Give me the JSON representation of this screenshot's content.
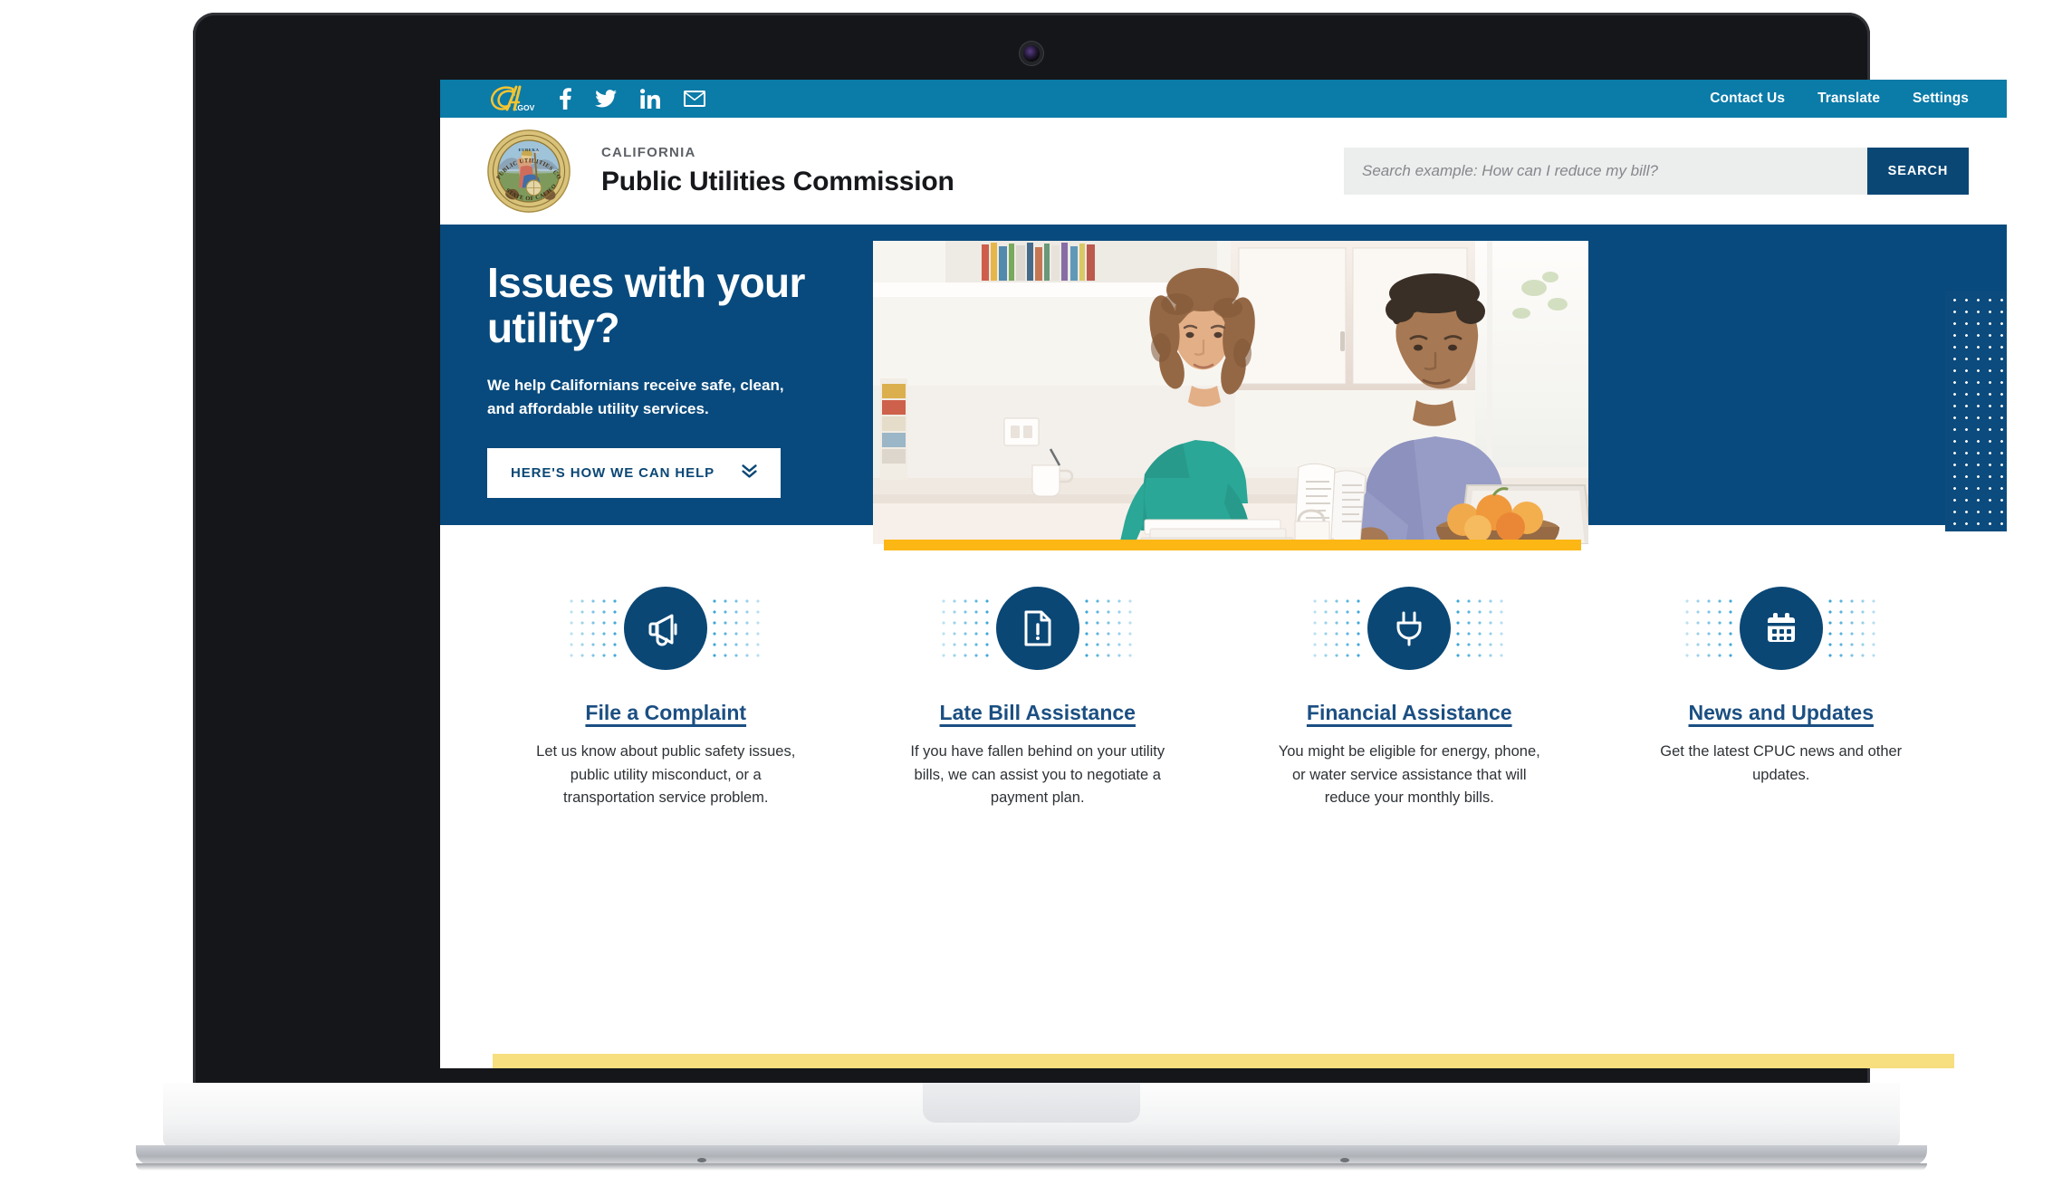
{
  "topbar": {
    "logo_alt": "CA.gov",
    "social": [
      {
        "name": "facebook-icon",
        "label": "Facebook"
      },
      {
        "name": "twitter-icon",
        "label": "Twitter"
      },
      {
        "name": "linkedin-icon",
        "label": "LinkedIn"
      },
      {
        "name": "email-icon",
        "label": "Email"
      }
    ],
    "links": [
      {
        "label": "Contact Us"
      },
      {
        "label": "Translate"
      },
      {
        "label": "Settings"
      }
    ],
    "bg_color": "#0b7ba8"
  },
  "masthead": {
    "seal_alt": "Seal of the Public Utilities Commission, State of California, Eureka",
    "eyebrow": "CALIFORNIA",
    "title": "Public Utilities Commission",
    "search": {
      "placeholder": "Search example: How can I reduce my bill?",
      "value": "",
      "button_label": "SEARCH",
      "button_color": "#0a4775"
    }
  },
  "hero": {
    "title": "Issues with your utility?",
    "subtitle": "We help Californians receive safe, clean, and affordable utility services.",
    "cta_label": "HERE'S HOW WE CAN HELP",
    "cta_icon": "double-chevron-down-icon",
    "bg_color": "#084a7d",
    "accent_color": "#fcb714",
    "photo_alt": "A woman in a teal shirt and a man in a lavender shirt reviewing bills at a laptop in a bright kitchen"
  },
  "cards": [
    {
      "icon": "megaphone-icon",
      "title": "File a Complaint",
      "text": "Let us know about public safety issues, public utility misconduct, or a transportation service problem."
    },
    {
      "icon": "document-alert-icon",
      "title": "Late Bill Assistance",
      "text": "If you have fallen behind on your utility bills, we can assist you to negotiate a payment plan."
    },
    {
      "icon": "power-plug-icon",
      "title": "Financial Assistance",
      "text": "You might be eligible for energy, phone, or water service assistance that will reduce your monthly bills."
    },
    {
      "icon": "calendar-icon",
      "title": "News and Updates",
      "text": "Get the latest CPUC news and other updates."
    }
  ],
  "footer_accent_color": "#f7de7f"
}
